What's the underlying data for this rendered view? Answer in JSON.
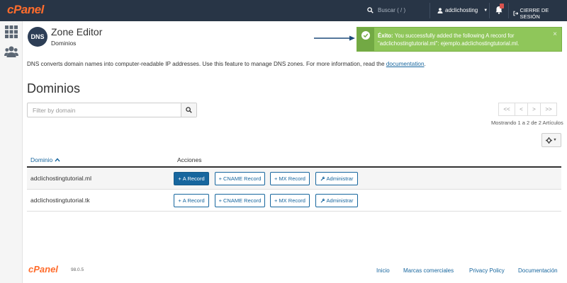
{
  "topbar": {
    "logo": "cPanel",
    "search_placeholder": "Buscar ( / )",
    "username": "adclichosting",
    "logout": "CIERRE DE SESIÓN"
  },
  "header": {
    "icon_text": "DNS",
    "title": "Zone Editor",
    "subtitle": "Dominios"
  },
  "alert": {
    "label": "Éxito:",
    "message": "You successfully added the following A record for \"adclichostingtutorial.ml\": ejemplo.adclichostingtutorial.ml.",
    "close": "×",
    "color": "#8fc65a"
  },
  "description": {
    "text": "DNS converts domain names into computer-readable IP addresses. Use this feature to manage DNS zones. For more information, read the ",
    "link": "documentation",
    "suffix": "."
  },
  "main": {
    "heading": "Dominios",
    "filter_placeholder": "Filter by domain",
    "pagination": [
      "<<",
      "<",
      ">",
      ">>"
    ],
    "showing": "Mostrando 1 a 2 de 2 Artículos"
  },
  "table": {
    "col_domain": "Dominio",
    "col_actions": "Acciones",
    "rows": [
      {
        "domain": "adclichostingtutorial.ml"
      },
      {
        "domain": "adclichostingtutorial.tk"
      }
    ],
    "actions": {
      "a_record": "A Record",
      "cname_record": "CNAME Record",
      "mx_record": "MX Record",
      "manage": "Administrar"
    }
  },
  "footer": {
    "logo": "cPanel",
    "version": "98.0.5",
    "links": [
      "Inicio",
      "Marcas comerciales",
      "Privacy Policy",
      "Documentación"
    ]
  },
  "colors": {
    "topbar": "#283546",
    "brand_orange": "#ff6c2c",
    "link_blue": "#17669e"
  }
}
